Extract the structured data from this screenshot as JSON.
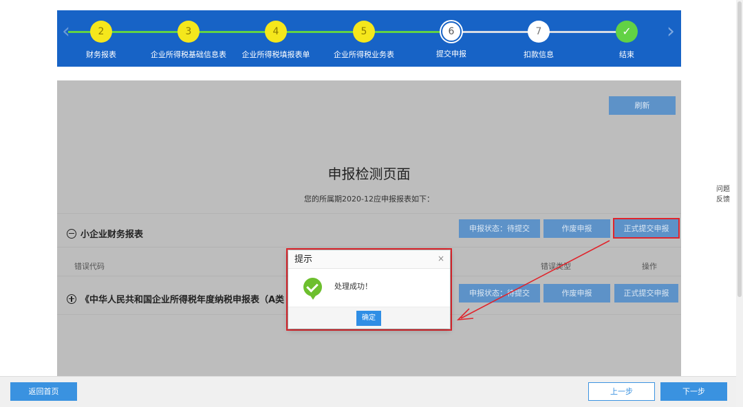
{
  "stepper": {
    "steps": [
      {
        "num": "2",
        "label": "财务报表",
        "state": "done"
      },
      {
        "num": "3",
        "label": "企业所得税基础信息表",
        "state": "done"
      },
      {
        "num": "4",
        "label": "企业所得税填报表单",
        "state": "done"
      },
      {
        "num": "5",
        "label": "企业所得税业务表",
        "state": "done"
      },
      {
        "num": "6",
        "label": "提交申报",
        "state": "current"
      },
      {
        "num": "7",
        "label": "扣款信息",
        "state": "todo"
      },
      {
        "num": "✓",
        "label": "结束",
        "state": "finish"
      }
    ],
    "prev_arrow": "‹",
    "next_arrow": "›"
  },
  "main": {
    "refresh_label": "刷新",
    "title": "申报检测页面",
    "subtitle": "您的所属期2020-12应申报报表如下：",
    "section1": {
      "title": "小企业财务报表",
      "status_label": "申报状态：待提交",
      "void_label": "作废申报",
      "submit_label": "正式提交申报"
    },
    "columns": {
      "error_code": "错误代码",
      "error_type": "错误类型",
      "operation": "操作"
    },
    "section2": {
      "title": "《中华人民共和国企业所得税年度纳税申报表（A类",
      "status_label": "申报状态：待提交",
      "void_label": "作废申报",
      "submit_label": "正式提交申报"
    }
  },
  "modal": {
    "title": "提示",
    "close": "×",
    "message": "处理成功！",
    "ok_label": "确定"
  },
  "feedback": {
    "line1": "问题",
    "line2": "反馈"
  },
  "footer": {
    "home_label": "返回首页",
    "prev_label": "上一步",
    "next_label": "下一步"
  },
  "colors": {
    "stepper_bg": "#1763c6",
    "step_done": "#f5e71c",
    "step_line_done": "#62d245",
    "action_button": "#5d92c8",
    "primary_button": "#3a92e0",
    "annotation_red": "#e0242b",
    "success_icon": "#6dbf2e"
  }
}
